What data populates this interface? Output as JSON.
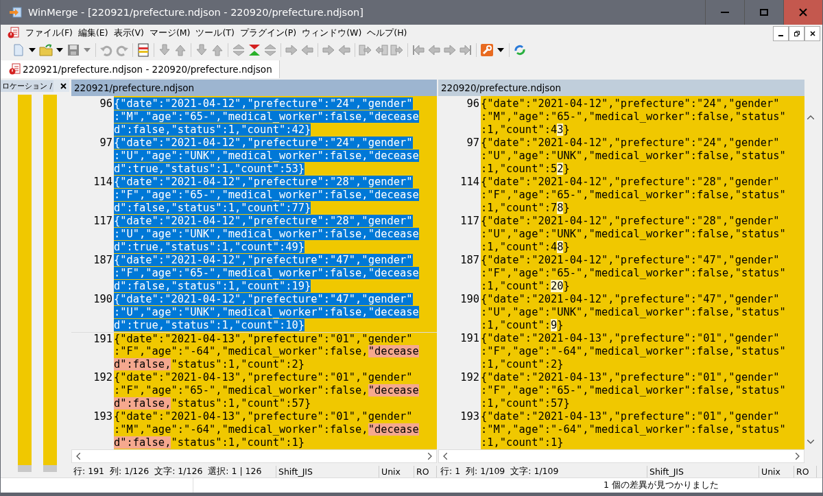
{
  "window": {
    "title": "WinMerge - [220921/prefecture.ndjson - 220920/prefecture.ndjson]"
  },
  "menu": [
    {
      "label": "ファイル(F)"
    },
    {
      "label": "編集(E)"
    },
    {
      "label": "表示(V)"
    },
    {
      "label": "マージ(M)"
    },
    {
      "label": "ツール(T)"
    },
    {
      "label": "プラグイン(P)"
    },
    {
      "label": "ウィンドウ(W)"
    },
    {
      "label": "ヘルプ(H)"
    }
  ],
  "document_tab": {
    "label": "220921/prefecture.ndjson - 220920/prefecture.ndjson"
  },
  "location_pane": {
    "title": "ロケーション /"
  },
  "panes": [
    {
      "header": "220921/prefecture.ndjson",
      "active": true,
      "lines": [
        {
          "number": "96",
          "selected": true,
          "rows": [
            {
              "segments": [
                {
                  "text": "{\"date\":\"2021-04-12\",\"prefecture\":\"24\",\"gender\"",
                  "diff": false
                }
              ]
            },
            {
              "segments": [
                {
                  "text": ":\"M\",\"age\":\"65-\",\"medical_worker\":false,\"decease",
                  "diff": false
                }
              ]
            },
            {
              "segments": [
                {
                  "text": "d\":false,\"status\":1,\"count\":42}",
                  "diff": false
                }
              ]
            }
          ]
        },
        {
          "number": "97",
          "selected": true,
          "rows": [
            {
              "segments": [
                {
                  "text": "{\"date\":\"2021-04-12\",\"prefecture\":\"24\",\"gender\"",
                  "diff": false
                }
              ]
            },
            {
              "segments": [
                {
                  "text": ":\"U\",\"age\":\"UNK\",\"medical_worker\":false,\"decease",
                  "diff": false
                }
              ]
            },
            {
              "segments": [
                {
                  "text": "d\":true,\"status\":1,\"count\":53}",
                  "diff": false
                }
              ]
            }
          ]
        },
        {
          "number": "114",
          "selected": true,
          "rows": [
            {
              "segments": [
                {
                  "text": "{\"date\":\"2021-04-12\",\"prefecture\":\"28\",\"gender\"",
                  "diff": false
                }
              ]
            },
            {
              "segments": [
                {
                  "text": ":\"F\",\"age\":\"65-\",\"medical_worker\":false,\"decease",
                  "diff": false
                }
              ]
            },
            {
              "segments": [
                {
                  "text": "d\":false,\"status\":1,\"count\":77}",
                  "diff": false
                }
              ]
            }
          ]
        },
        {
          "number": "117",
          "selected": true,
          "rows": [
            {
              "segments": [
                {
                  "text": "{\"date\":\"2021-04-12\",\"prefecture\":\"28\",\"gender\"",
                  "diff": false
                }
              ]
            },
            {
              "segments": [
                {
                  "text": ":\"U\",\"age\":\"UNK\",\"medical_worker\":false,\"decease",
                  "diff": false
                }
              ]
            },
            {
              "segments": [
                {
                  "text": "d\":true,\"status\":1,\"count\":49}",
                  "diff": false
                }
              ]
            }
          ]
        },
        {
          "number": "187",
          "selected": true,
          "rows": [
            {
              "segments": [
                {
                  "text": "{\"date\":\"2021-04-12\",\"prefecture\":\"47\",\"gender\"",
                  "diff": false
                }
              ]
            },
            {
              "segments": [
                {
                  "text": ":\"F\",\"age\":\"65-\",\"medical_worker\":false,\"decease",
                  "diff": false
                }
              ]
            },
            {
              "segments": [
                {
                  "text": "d\":false,\"status\":1,\"count\":19}",
                  "diff": false
                }
              ]
            }
          ]
        },
        {
          "number": "190",
          "selected": true,
          "rows": [
            {
              "segments": [
                {
                  "text": "{\"date\":\"2021-04-12\",\"prefecture\":\"47\",\"gender\"",
                  "diff": false
                }
              ]
            },
            {
              "segments": [
                {
                  "text": ":\"U\",\"age\":\"UNK\",\"medical_worker\":false,\"decease",
                  "diff": false
                }
              ]
            },
            {
              "segments": [
                {
                  "text": "d\":true,\"status\":1,\"count\":10}",
                  "diff": false
                }
              ]
            }
          ]
        },
        {
          "number": "191",
          "selected": false,
          "rows": [
            {
              "segments": [
                {
                  "text": "{\"date\":\"2021-04-13\",\"prefecture\":\"01\",\"gender\"",
                  "diff": false
                }
              ]
            },
            {
              "segments": [
                {
                  "text": ":\"F\",\"age\":\"-64\",\"medical_worker\":false,",
                  "diff": false
                },
                {
                  "text": "\"decease",
                  "diff": true
                }
              ]
            },
            {
              "segments": [
                {
                  "text": "d\":false,",
                  "diff": true
                },
                {
                  "text": "\"status\":1,\"count\":2}",
                  "diff": false
                }
              ]
            }
          ]
        },
        {
          "number": "192",
          "selected": false,
          "rows": [
            {
              "segments": [
                {
                  "text": "{\"date\":\"2021-04-13\",\"prefecture\":\"01\",\"gender\"",
                  "diff": false
                }
              ]
            },
            {
              "segments": [
                {
                  "text": ":\"F\",\"age\":\"65-\",\"medical_worker\":false,",
                  "diff": false
                },
                {
                  "text": "\"decease",
                  "diff": true
                }
              ]
            },
            {
              "segments": [
                {
                  "text": "d\":false,",
                  "diff": true
                },
                {
                  "text": "\"status\":1,\"count\":57}",
                  "diff": false
                }
              ]
            }
          ]
        },
        {
          "number": "193",
          "selected": false,
          "rows": [
            {
              "segments": [
                {
                  "text": "{\"date\":\"2021-04-13\",\"prefecture\":\"01\",\"gender\"",
                  "diff": false
                }
              ]
            },
            {
              "segments": [
                {
                  "text": ":\"M\",\"age\":\"-64\",\"medical_worker\":false,",
                  "diff": false
                },
                {
                  "text": "\"decease",
                  "diff": true
                }
              ]
            },
            {
              "segments": [
                {
                  "text": "d\":false,",
                  "diff": true
                },
                {
                  "text": "\"status\":1,\"count\":1}",
                  "diff": false
                }
              ]
            }
          ]
        }
      ],
      "status": {
        "position": "行: 191  列: 1/126  文字: 1/126  選択: 1 | 126",
        "encoding": "Shift_JIS",
        "eol": "Unix",
        "mode": "RO"
      }
    },
    {
      "header": "220920/prefecture.ndjson",
      "active": false,
      "lines": [
        {
          "number": "96",
          "selected": false,
          "rows": [
            {
              "segments": [
                {
                  "text": "{\"date\":\"2021-04-12\",\"prefecture\":\"24\",\"gender\"",
                  "diff": false
                }
              ]
            },
            {
              "segments": [
                {
                  "text": ":\"M\",\"age\":\"65-\",\"medical_worker\":false,\"status\"",
                  "diff": false
                }
              ]
            },
            {
              "segments": [
                {
                  "text": ":1,\"count\":4",
                  "diff": false
                },
                {
                  "text": "3",
                  "diff": true
                },
                {
                  "text": "}",
                  "diff": false
                }
              ]
            }
          ]
        },
        {
          "number": "97",
          "selected": false,
          "rows": [
            {
              "segments": [
                {
                  "text": "{\"date\":\"2021-04-12\",\"prefecture\":\"24\",\"gender\"",
                  "diff": false
                }
              ]
            },
            {
              "segments": [
                {
                  "text": ":\"U\",\"age\":\"UNK\",\"medical_worker\":false,\"status\"",
                  "diff": false
                }
              ]
            },
            {
              "segments": [
                {
                  "text": ":1,\"count\":5",
                  "diff": false
                },
                {
                  "text": "2",
                  "diff": true
                },
                {
                  "text": "}",
                  "diff": false
                }
              ]
            }
          ]
        },
        {
          "number": "114",
          "selected": false,
          "rows": [
            {
              "segments": [
                {
                  "text": "{\"date\":\"2021-04-12\",\"prefecture\":\"28\",\"gender\"",
                  "diff": false
                }
              ]
            },
            {
              "segments": [
                {
                  "text": ":\"F\",\"age\":\"65-\",\"medical_worker\":false,\"status\"",
                  "diff": false
                }
              ]
            },
            {
              "segments": [
                {
                  "text": ":1,\"count\":7",
                  "diff": false
                },
                {
                  "text": "8",
                  "diff": true
                },
                {
                  "text": "}",
                  "diff": false
                }
              ]
            }
          ]
        },
        {
          "number": "117",
          "selected": false,
          "rows": [
            {
              "segments": [
                {
                  "text": "{\"date\":\"2021-04-12\",\"prefecture\":\"28\",\"gender\"",
                  "diff": false
                }
              ]
            },
            {
              "segments": [
                {
                  "text": ":\"U\",\"age\":\"UNK\",\"medical_worker\":false,\"status\"",
                  "diff": false
                }
              ]
            },
            {
              "segments": [
                {
                  "text": ":1,\"count\":4",
                  "diff": false
                },
                {
                  "text": "8",
                  "diff": true
                },
                {
                  "text": "}",
                  "diff": false
                }
              ]
            }
          ]
        },
        {
          "number": "187",
          "selected": false,
          "rows": [
            {
              "segments": [
                {
                  "text": "{\"date\":\"2021-04-12\",\"prefecture\":\"47\",\"gender\"",
                  "diff": false
                }
              ]
            },
            {
              "segments": [
                {
                  "text": ":\"F\",\"age\":\"65-\",\"medical_worker\":false,\"status\"",
                  "diff": false
                }
              ]
            },
            {
              "segments": [
                {
                  "text": ":1,\"count\":",
                  "diff": false
                },
                {
                  "text": "20",
                  "diff": true
                },
                {
                  "text": "}",
                  "diff": false
                }
              ]
            }
          ]
        },
        {
          "number": "190",
          "selected": false,
          "rows": [
            {
              "segments": [
                {
                  "text": "{\"date\":\"2021-04-12\",\"prefecture\":\"47\",\"gender\"",
                  "diff": false
                }
              ]
            },
            {
              "segments": [
                {
                  "text": ":\"U\",\"age\":\"UNK\",\"medical_worker\":false,\"status\"",
                  "diff": false
                }
              ]
            },
            {
              "segments": [
                {
                  "text": ":1,\"count\":",
                  "diff": false
                },
                {
                  "text": "9",
                  "diff": true
                },
                {
                  "text": "}",
                  "diff": false
                }
              ]
            }
          ]
        },
        {
          "number": "191",
          "selected": false,
          "rows": [
            {
              "segments": [
                {
                  "text": "{\"date\":\"2021-04-13\",\"prefecture\":\"01\",\"gender\"",
                  "diff": false
                }
              ]
            },
            {
              "segments": [
                {
                  "text": ":\"F\",\"age\":\"-64\",\"medical_worker\":false,\"status\"",
                  "diff": false
                }
              ]
            },
            {
              "segments": [
                {
                  "text": ":1,\"count\":2}",
                  "diff": false
                }
              ]
            }
          ]
        },
        {
          "number": "192",
          "selected": false,
          "rows": [
            {
              "segments": [
                {
                  "text": "{\"date\":\"2021-04-13\",\"prefecture\":\"01\",\"gender\"",
                  "diff": false
                }
              ]
            },
            {
              "segments": [
                {
                  "text": ":\"F\",\"age\":\"65-\",\"medical_worker\":false,\"status\"",
                  "diff": false
                }
              ]
            },
            {
              "segments": [
                {
                  "text": ":1,\"count\":57}",
                  "diff": false
                }
              ]
            }
          ]
        },
        {
          "number": "193",
          "selected": false,
          "rows": [
            {
              "segments": [
                {
                  "text": "{\"date\":\"2021-04-13\",\"prefecture\":\"01\",\"gender\"",
                  "diff": false
                }
              ]
            },
            {
              "segments": [
                {
                  "text": ":\"M\",\"age\":\"-64\",\"medical_worker\":false,\"status\"",
                  "diff": false
                }
              ]
            },
            {
              "segments": [
                {
                  "text": ":1,\"count\":1}",
                  "diff": false
                }
              ]
            }
          ]
        }
      ],
      "status": {
        "position": "行: 1  列: 1/109  文字: 1/109",
        "encoding": "Shift_JIS",
        "eol": "Unix",
        "mode": "RO"
      }
    }
  ],
  "status_bar": {
    "message": "1 個の差異が見つかりました"
  }
}
